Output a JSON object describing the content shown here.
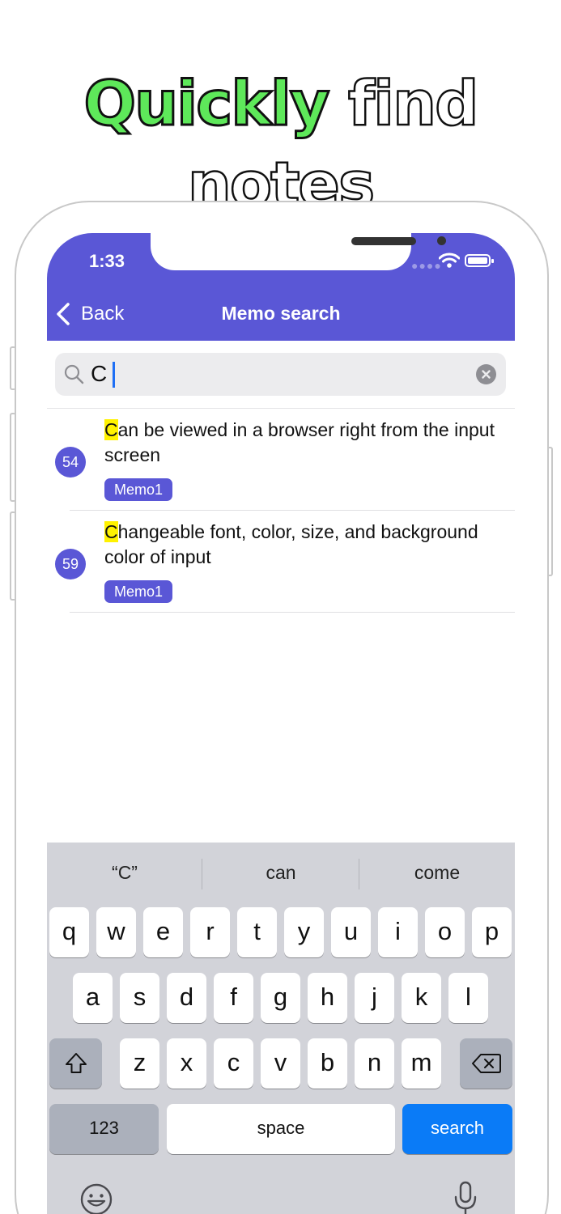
{
  "headline": {
    "highlight": "Quickly",
    "rest": "find notes"
  },
  "status_bar": {
    "time": "1:33"
  },
  "nav": {
    "back_label": "Back",
    "title": "Memo search"
  },
  "search": {
    "query": "C",
    "placeholder": ""
  },
  "results": [
    {
      "number": "54",
      "match": "C",
      "text_rest": "an be viewed in a browser right from the input screen",
      "tag": "Memo1"
    },
    {
      "number": "59",
      "match": "C",
      "text_rest": "hangeable font, color, size, and background color of input",
      "tag": "Memo1"
    }
  ],
  "keyboard": {
    "suggestions": [
      "“C”",
      "can",
      "come"
    ],
    "row1": [
      "q",
      "w",
      "e",
      "r",
      "t",
      "y",
      "u",
      "i",
      "o",
      "p"
    ],
    "row2": [
      "a",
      "s",
      "d",
      "f",
      "g",
      "h",
      "j",
      "k",
      "l"
    ],
    "row3": [
      "z",
      "x",
      "c",
      "v",
      "b",
      "n",
      "m"
    ],
    "numbers_label": "123",
    "space_label": "space",
    "action_label": "search"
  },
  "colors": {
    "accent": "#5a57d6",
    "highlight": "#fff200",
    "headline_green": "#5ee85a",
    "search_key": "#0a7bf7"
  },
  "icons": [
    "back-chevron-icon",
    "search-icon",
    "clear-icon",
    "wifi-icon",
    "battery-icon",
    "shift-icon",
    "delete-icon",
    "emoji-icon",
    "microphone-icon"
  ]
}
